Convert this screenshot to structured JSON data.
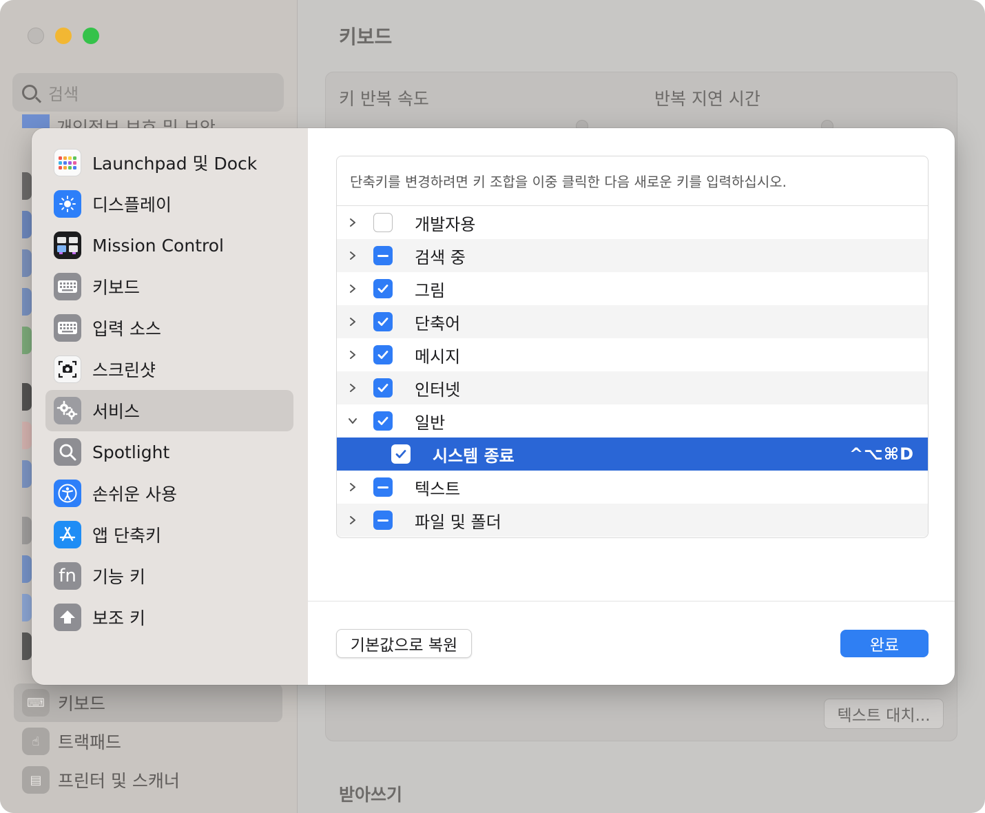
{
  "background": {
    "search_placeholder": "검색",
    "partial_sidebar_label": "개인정보 보호 및 보안",
    "sidebar_bottom_items": [
      {
        "label": "키보드",
        "icon": "keyboard-icon",
        "selected": true
      },
      {
        "label": "트랙패드",
        "icon": "trackpad-icon",
        "selected": false
      },
      {
        "label": "프린터 및 스캐너",
        "icon": "printer-icon",
        "selected": false
      }
    ],
    "main_title": "키보드",
    "key_repeat_rate_label": "키 반복 속도",
    "delay_until_repeat_label": "반복 지연 시간",
    "text_replacement_button": "텍스트 대치...",
    "dictation_heading": "받아쓰기"
  },
  "sheet": {
    "sidebar_items": [
      {
        "label": "Launchpad 및 Dock",
        "icon": "launchpad-icon"
      },
      {
        "label": "디스플레이",
        "icon": "display-brightness-icon"
      },
      {
        "label": "Mission Control",
        "icon": "mission-control-icon"
      },
      {
        "label": "키보드",
        "icon": "keyboard-icon"
      },
      {
        "label": "입력 소스",
        "icon": "input-sources-icon"
      },
      {
        "label": "스크린샷",
        "icon": "screenshot-camera-icon"
      },
      {
        "label": "서비스",
        "icon": "services-gears-icon",
        "selected": true
      },
      {
        "label": "Spotlight",
        "icon": "spotlight-search-icon"
      },
      {
        "label": "손쉬운 사용",
        "icon": "accessibility-icon"
      },
      {
        "label": "앱 단축키",
        "icon": "app-shortcuts-icon"
      },
      {
        "label": "기능 키",
        "icon": "function-keys-icon",
        "glyph": "fn"
      },
      {
        "label": "보조 키",
        "icon": "modifier-keys-icon"
      }
    ],
    "hint": "단축키를 변경하려면 키 조합을 이중 클릭한 다음 새로운 키를 입력하십시오.",
    "rows": [
      {
        "label": "개발자용",
        "state": "unchecked",
        "expanded": false
      },
      {
        "label": "검색 중",
        "state": "mixed",
        "expanded": false
      },
      {
        "label": "그림",
        "state": "checked",
        "expanded": false
      },
      {
        "label": "단축어",
        "state": "checked",
        "expanded": false
      },
      {
        "label": "메시지",
        "state": "checked",
        "expanded": false
      },
      {
        "label": "인터넷",
        "state": "checked",
        "expanded": false
      },
      {
        "label": "일반",
        "state": "checked",
        "expanded": true
      },
      {
        "label": "시스템 종료",
        "state": "checked",
        "child": true,
        "selected": true,
        "shortcut": "^⌥⌘D"
      },
      {
        "label": "텍스트",
        "state": "mixed",
        "expanded": false
      },
      {
        "label": "파일 및 폴더",
        "state": "mixed",
        "expanded": false
      }
    ],
    "restore_defaults_button": "기본값으로 복원",
    "done_button": "완료"
  },
  "colors": {
    "accent": "#2f7ff3",
    "selection_row": "#2a66d6",
    "sheet_sidebar": "#e6e2df",
    "window_dimmed": "#c8c7c5"
  }
}
